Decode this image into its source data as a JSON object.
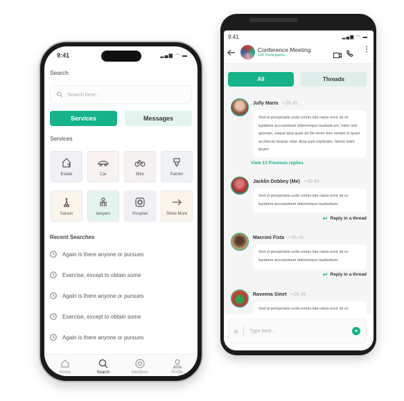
{
  "colors": {
    "accent": "#14b38a",
    "accent_light": "#e3f4ef"
  },
  "left": {
    "status_time": "9:41",
    "title": "Search",
    "search_placeholder": "Search here...",
    "tabs": [
      "Services",
      "Messages"
    ],
    "section_services": "Services",
    "services": [
      {
        "label": "Estate",
        "icon": "house-icon",
        "bg": "#f0f0f6"
      },
      {
        "label": "Car",
        "icon": "car-icon",
        "bg": "#f8f3f0"
      },
      {
        "label": "Bike",
        "icon": "bike-icon",
        "bg": "#f5f1f1"
      },
      {
        "label": "Painter",
        "icon": "paint-brush-icon",
        "bg": "#eef4f5"
      },
      {
        "label": "Saloon",
        "icon": "scissors-icon",
        "bg": "#fbf5ec"
      },
      {
        "label": "lawyers",
        "icon": "lawyer-icon",
        "bg": "#e3f4ef"
      },
      {
        "label": "Hospital",
        "icon": "hospital-icon",
        "bg": "#f0f0f6"
      },
      {
        "label": "Show More",
        "icon": "arrow-right-icon",
        "bg": "#fbf5ec"
      }
    ],
    "section_recent": "Recent Searches",
    "recent": [
      "Again is there anyone or pursues",
      "Exercise, except to obtain some",
      "Again is there anyone or pursues",
      "Exercise, except to obtain some",
      "Again is there anyone or pursues"
    ],
    "nav": [
      "Home",
      "Search",
      "Mentions",
      "Profile"
    ]
  },
  "right": {
    "status_time": "9:41",
    "chat_title": "Conference Meeting",
    "participants": "100 Participants",
    "tabs": [
      "All",
      "Threads"
    ],
    "messages": [
      {
        "name": "Jully Mario",
        "time": "09.45",
        "text": "Sed ut perspiciatis unde omnis iste natus error sit vo luptatem accusantium doloremque laudanti um, totim  rem aperiam, eaque ipsa quae ab illo inven tore veritati et quasi architecto beatae vitae dicta sunt explicabo. Nemo enim ipsam"
      },
      {
        "name": "Jacklin Dobbey (Me)",
        "time": "09.45",
        "text": "Sed ut perspiciatis unde omnis iste natus error sit vo luptatem accusantium doloremque laudantium."
      },
      {
        "name": "Macroni Fista",
        "time": "09.45",
        "text": "Sed ut perspiciatis unde omnis iste natus error sit vo luptatem accusantium doloremque laudantium."
      },
      {
        "name": "Raveena Simrt",
        "time": "09.45",
        "text": "Sed ut perspiciatis unde omnis iste natus error sit vo luptatem accusantium doloremque laudantium."
      }
    ],
    "view_replies": "View 13 Previous replies",
    "reply_label": "Reply in a thread",
    "input_placeholder": "Type here..."
  }
}
